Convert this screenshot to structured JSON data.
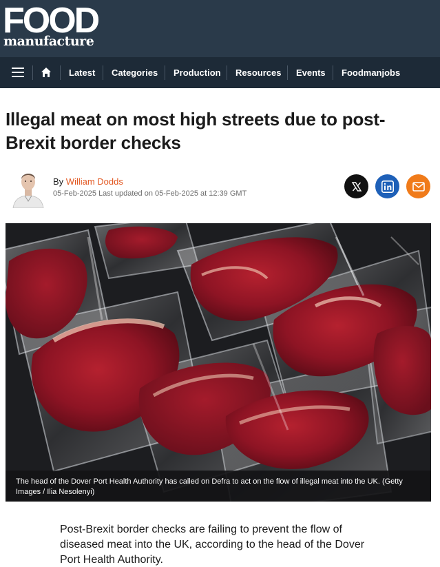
{
  "brand": {
    "logo_top": "FOOD",
    "logo_bottom": "manufacture"
  },
  "nav": {
    "menu_icon": "hamburger-menu-icon",
    "home_icon": "home-icon",
    "items": [
      {
        "label": "Latest"
      },
      {
        "label": "Categories"
      },
      {
        "label": "Production"
      },
      {
        "label": "Resources"
      },
      {
        "label": "Events"
      },
      {
        "label": "Foodmanjobs"
      }
    ]
  },
  "article": {
    "headline": "Illegal meat on most high streets due to post-Brexit border checks",
    "by_prefix": "By ",
    "author": "William Dodds",
    "dates": "05-Feb-2025 Last updated on 05-Feb-2025 at 12:39 GMT",
    "image_caption": "The head of the Dover Port Health Authority has called on Defra to act on the flow of illegal meat into the UK. (Getty Images / Ilia Nesolenyi)",
    "intro": "Post-Brexit border checks are failing to prevent the flow of diseased meat into the UK, according to the head of the Dover Port Health Authority."
  },
  "share": {
    "icons": [
      "x-icon",
      "linkedin-icon",
      "email-icon"
    ],
    "colors": {
      "x": "#111111",
      "linkedin": "#1e60b8",
      "email": "#f07b1a"
    }
  },
  "colors": {
    "header": "#2a3a4a",
    "nav": "#1d2a37",
    "author_link": "#e2561f"
  }
}
